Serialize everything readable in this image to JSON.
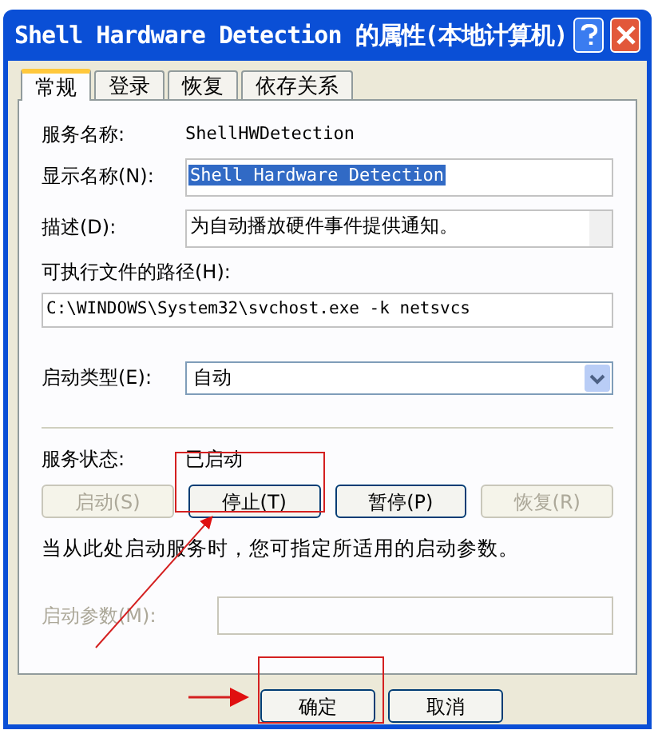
{
  "window": {
    "title": "Shell Hardware Detection 的属性(本地计算机)"
  },
  "tabs": [
    {
      "label": "常规",
      "selected": true
    },
    {
      "label": "登录",
      "selected": false
    },
    {
      "label": "恢复",
      "selected": false
    },
    {
      "label": "依存关系",
      "selected": false
    }
  ],
  "service_name": {
    "label": "服务名称:",
    "value": "ShellHWDetection"
  },
  "display_name": {
    "label": "显示名称(N):",
    "value": "Shell Hardware Detection",
    "selected": true
  },
  "description": {
    "label": "描述(D):",
    "value": "为自动播放硬件事件提供通知。"
  },
  "path": {
    "label": "可执行文件的路径(H):",
    "value": "C:\\WINDOWS\\System32\\svchost.exe -k netsvcs"
  },
  "startup_type": {
    "label": "启动类型(E):",
    "value": "自动"
  },
  "service_status": {
    "label": "服务状态:",
    "value": "已启动"
  },
  "control_buttons": [
    {
      "label": "启动(S)",
      "disabled": true
    },
    {
      "label": "停止(T)",
      "disabled": false
    },
    {
      "label": "暂停(P)",
      "disabled": false
    },
    {
      "label": "恢复(R)",
      "disabled": true
    }
  ],
  "hint": "当从此处启动服务时，您可指定所适用的启动参数。",
  "start_params": {
    "label": "启动参数(M):",
    "disabled": true
  },
  "dialog_buttons": [
    {
      "label": "确定"
    },
    {
      "label": "取消"
    }
  ]
}
